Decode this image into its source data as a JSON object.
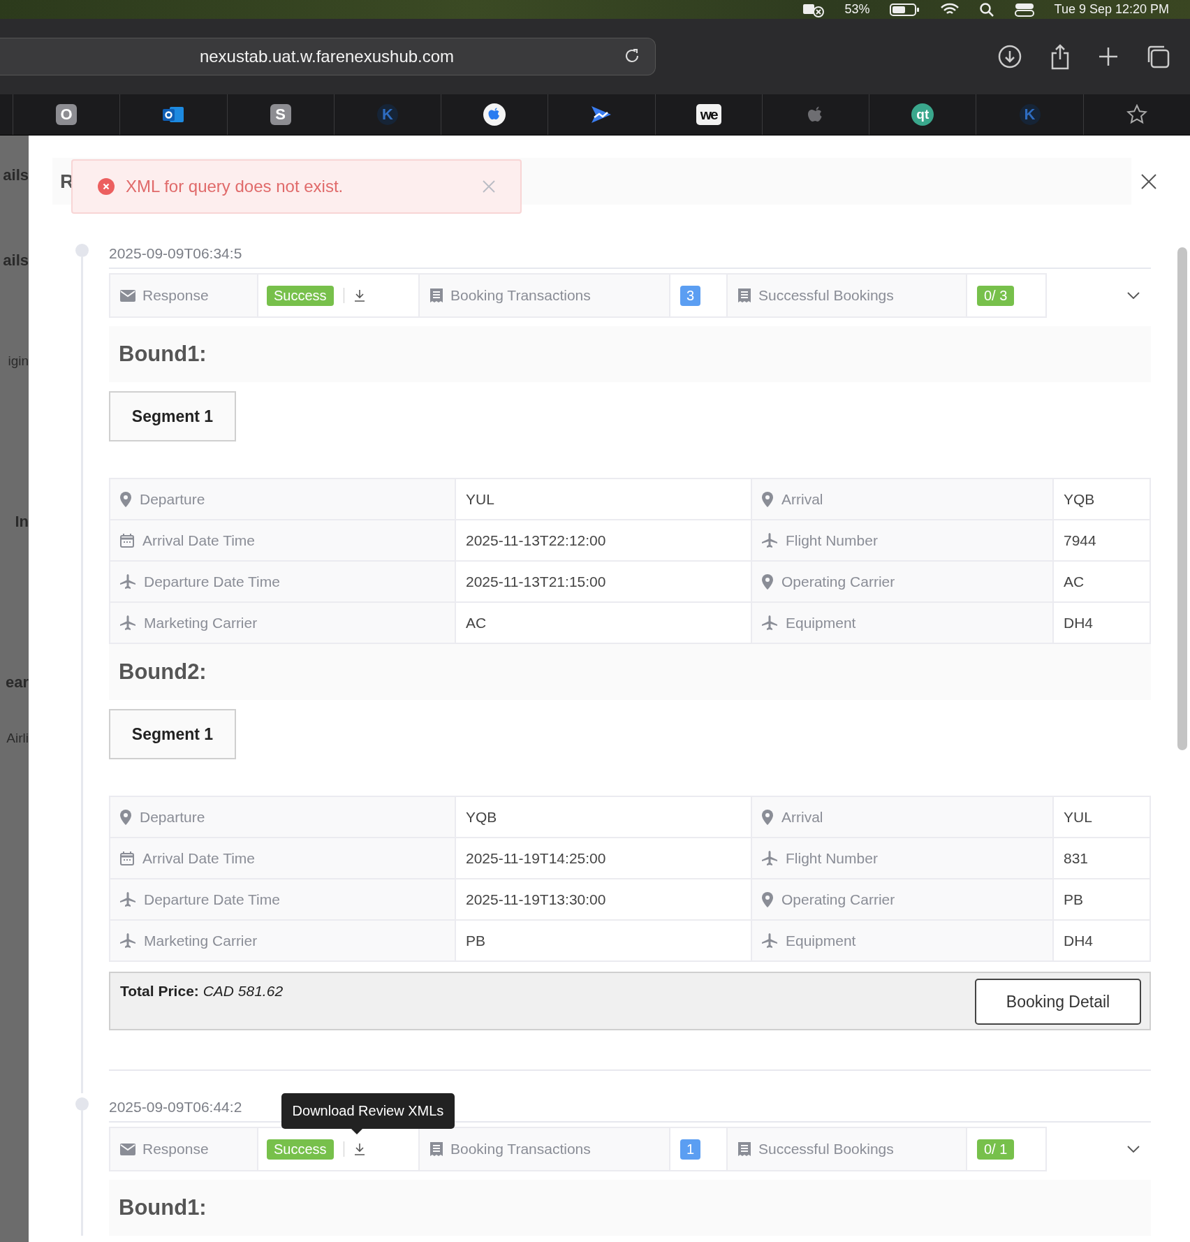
{
  "menubar": {
    "battery": "53%",
    "clock": "Tue 9 Sep  12:20 PM"
  },
  "browser": {
    "url": "nexustab.uat.w.farenexushub.com",
    "bookmarks": [
      {
        "kind": "letter",
        "text": "O"
      },
      {
        "kind": "outlook"
      },
      {
        "kind": "letter",
        "text": "S"
      },
      {
        "kind": "k",
        "text": "K"
      },
      {
        "kind": "apple-blue"
      },
      {
        "kind": "arrow"
      },
      {
        "kind": "we",
        "text": "we"
      },
      {
        "kind": "apple"
      },
      {
        "kind": "qt",
        "text": "qt"
      },
      {
        "kind": "k",
        "text": "K"
      },
      {
        "kind": "star"
      }
    ]
  },
  "background_page": {
    "labels": [
      {
        "kind": "heading",
        "text": "ails"
      },
      {
        "kind": "heading",
        "text": "ails"
      },
      {
        "kind": "text",
        "text": "igin"
      },
      {
        "kind": "heading",
        "text": "In"
      },
      {
        "kind": "heading",
        "text": "ear"
      },
      {
        "kind": "text",
        "text": "Airli"
      }
    ]
  },
  "modal": {
    "header": "R",
    "toast": {
      "message": "XML for query does not exist."
    },
    "entries": [
      {
        "timestamp": "2025-09-09T06:34:5",
        "response_label": "Response",
        "status": "Success",
        "transactions_label": "Booking Transactions",
        "transactions_count": "3",
        "bookings_label": "Successful Bookings",
        "bookings_count": "0/ 3",
        "bounds": [
          {
            "title": "Bound1:",
            "segments": [
              {
                "label": "Segment 1",
                "rows": [
                  [
                    {
                      "kind": "pin",
                      "label": "Departure",
                      "value": "YUL"
                    },
                    {
                      "kind": "pin",
                      "label": "Arrival",
                      "value": "YQB"
                    }
                  ],
                  [
                    {
                      "kind": "calendar",
                      "label": "Arrival Date Time",
                      "value": "2025-11-13T22:12:00"
                    },
                    {
                      "kind": "plane",
                      "label": "Flight Number",
                      "value": "7944"
                    }
                  ],
                  [
                    {
                      "kind": "plane",
                      "label": "Departure Date Time",
                      "value": "2025-11-13T21:15:00"
                    },
                    {
                      "kind": "pin",
                      "label": "Operating Carrier",
                      "value": "AC"
                    }
                  ],
                  [
                    {
                      "kind": "plane",
                      "label": "Marketing Carrier",
                      "value": "AC"
                    },
                    {
                      "kind": "plane",
                      "label": "Equipment",
                      "value": "DH4"
                    }
                  ]
                ]
              }
            ]
          },
          {
            "title": "Bound2:",
            "segments": [
              {
                "label": "Segment 1",
                "rows": [
                  [
                    {
                      "kind": "pin",
                      "label": "Departure",
                      "value": "YQB"
                    },
                    {
                      "kind": "pin",
                      "label": "Arrival",
                      "value": "YUL"
                    }
                  ],
                  [
                    {
                      "kind": "calendar",
                      "label": "Arrival Date Time",
                      "value": "2025-11-19T14:25:00"
                    },
                    {
                      "kind": "plane",
                      "label": "Flight Number",
                      "value": "831"
                    }
                  ],
                  [
                    {
                      "kind": "plane",
                      "label": "Departure Date Time",
                      "value": "2025-11-19T13:30:00"
                    },
                    {
                      "kind": "pin",
                      "label": "Operating Carrier",
                      "value": "PB"
                    }
                  ],
                  [
                    {
                      "kind": "plane",
                      "label": "Marketing Carrier",
                      "value": "PB"
                    },
                    {
                      "kind": "plane",
                      "label": "Equipment",
                      "value": "DH4"
                    }
                  ]
                ]
              }
            ]
          }
        ],
        "total": {
          "text": "**Total Price:** *CAD 581.62*",
          "button": "Booking Detail"
        }
      },
      {
        "timestamp": "2025-09-09T06:44:2",
        "response_label": "Response",
        "status": "Success",
        "transactions_label": "Booking Transactions",
        "transactions_count": "1",
        "bookings_label": "Successful Bookings",
        "bookings_count": "0/ 1",
        "tooltip": "Download Review XMLs",
        "bounds": [
          {
            "title": "Bound1:"
          }
        ]
      }
    ]
  }
}
